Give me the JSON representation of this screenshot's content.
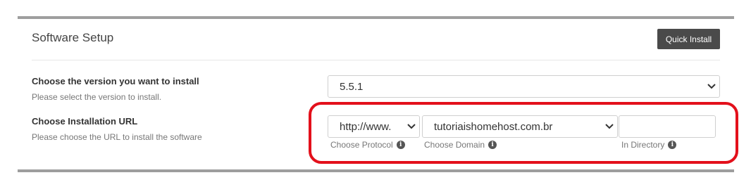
{
  "header": {
    "title": "Software Setup",
    "quick_install_label": "Quick Install"
  },
  "version": {
    "label": "Choose the version you want to install",
    "help": "Please select the version to install.",
    "selected": "5.5.1"
  },
  "install_url": {
    "label": "Choose Installation URL",
    "help": "Please choose the URL to install the software",
    "protocol": {
      "selected": "http://www.",
      "caption": "Choose Protocol"
    },
    "domain": {
      "selected": "tutoriaishomehost.com.br",
      "caption": "Choose Domain"
    },
    "directory": {
      "value": "",
      "caption": "In Directory"
    }
  },
  "icons": {
    "info": "info-icon",
    "chevron": "chevron-down-icon"
  },
  "colors": {
    "highlight": "#e3101b",
    "button_bg": "#4a4a4a"
  }
}
